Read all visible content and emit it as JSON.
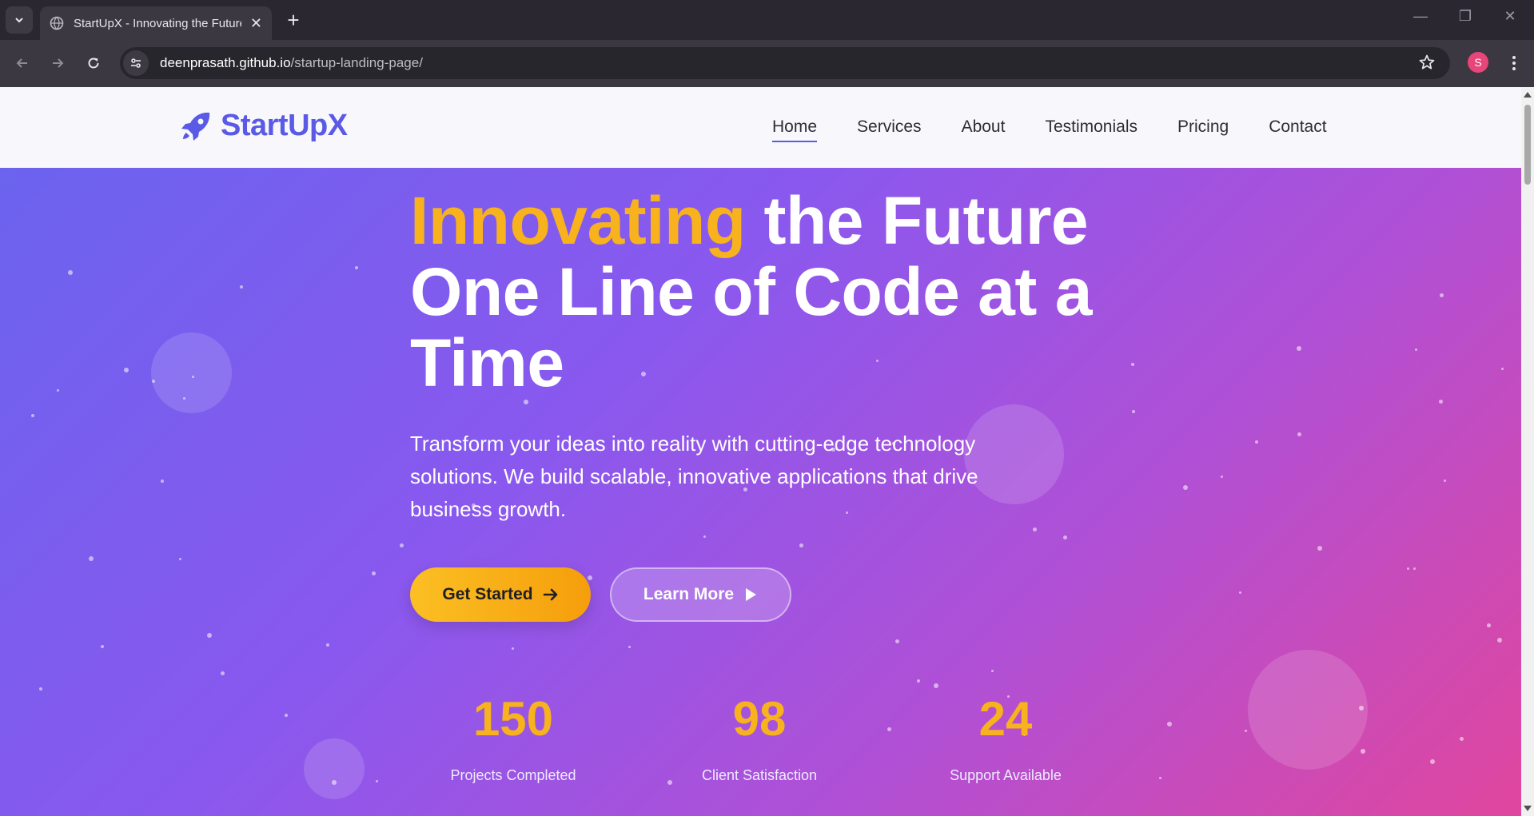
{
  "browser": {
    "tab_title": "StartUpX - Innovating the Future",
    "url_domain": "deenprasath.github.io",
    "url_path": "/startup-landing-page/",
    "profile_initial": "S"
  },
  "header": {
    "logo_text": "StartUpX",
    "nav": [
      {
        "label": "Home"
      },
      {
        "label": "Services"
      },
      {
        "label": "About"
      },
      {
        "label": "Testimonials"
      },
      {
        "label": "Pricing"
      },
      {
        "label": "Contact"
      }
    ],
    "active_nav": "Home"
  },
  "hero": {
    "title_accent": "Innovating",
    "title_rest_line1": " the Future",
    "title_line2": "One Line of Code at a",
    "title_line3": "Time",
    "subtitle": "Transform your ideas into reality with cutting-edge technology solutions. We build scalable, innovative applications that drive business growth.",
    "primary_button": "Get Started",
    "secondary_button": "Learn More"
  },
  "stats": [
    {
      "value": "150",
      "label": "Projects Completed"
    },
    {
      "value": "98",
      "label": "Client Satisfaction"
    },
    {
      "value": "24",
      "label": "Support Available"
    }
  ],
  "colors": {
    "brand": "#5a5ae6",
    "accent": "#f7b21e",
    "gradient_start": "#6b63ef",
    "gradient_end": "#e0469e"
  }
}
